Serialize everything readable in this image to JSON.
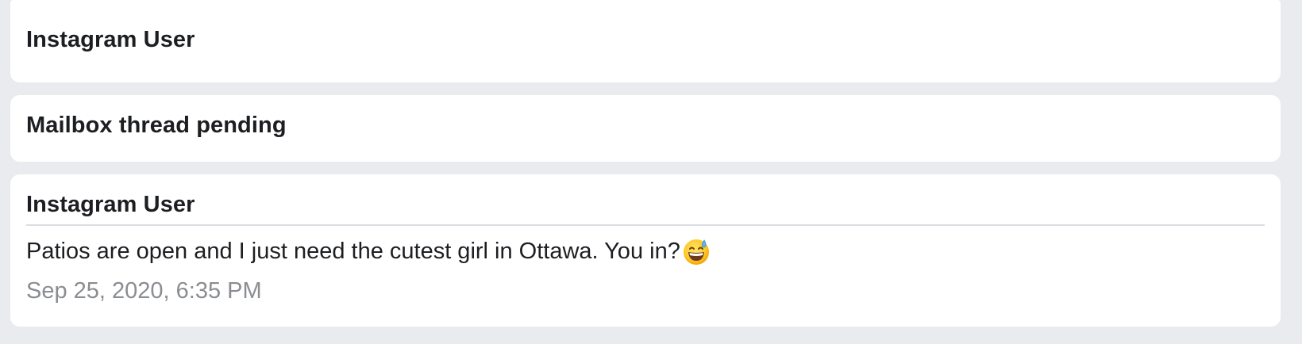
{
  "threads": [
    {
      "title": "Instagram User"
    },
    {
      "title": "Mailbox thread pending"
    },
    {
      "title": "Instagram User",
      "message": "Patios are open and I just need the cutest girl in Ottawa. You in?",
      "emoji": "grinning-face-with-sweat",
      "timestamp": "Sep 25, 2020, 6:35 PM"
    }
  ],
  "colors": {
    "background": "#e9ebee",
    "card": "#ffffff",
    "text": "#1c1e21",
    "muted": "#8a8d91",
    "divider": "#dadde1"
  }
}
